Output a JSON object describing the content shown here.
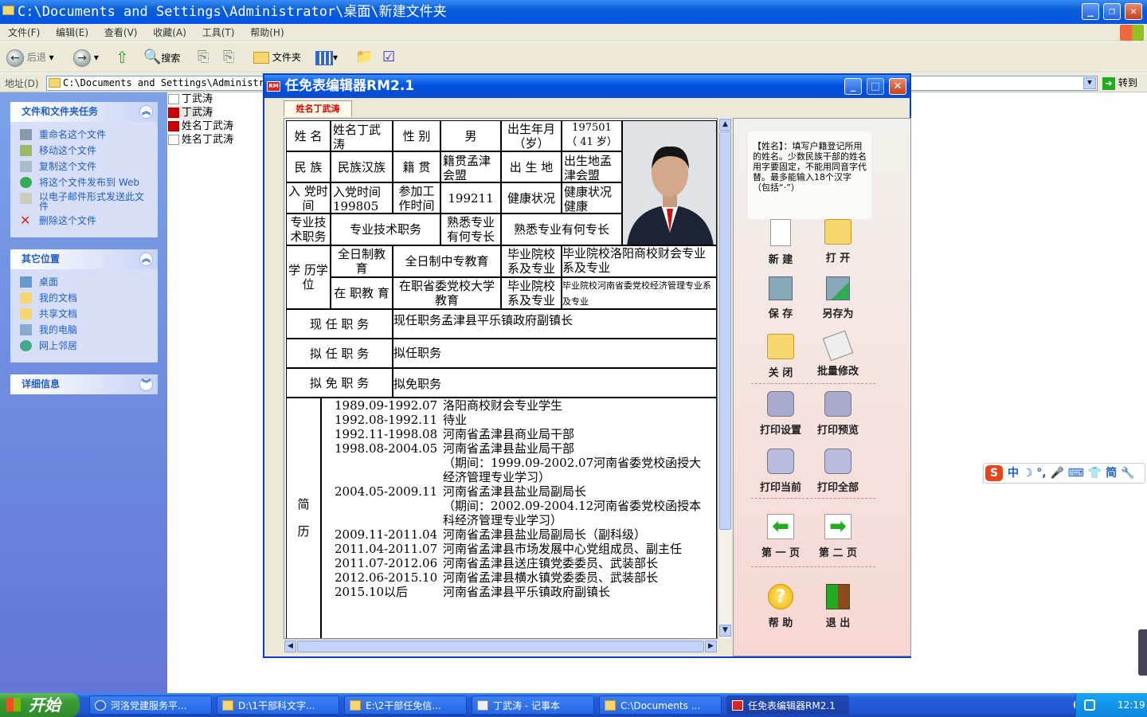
{
  "explorer": {
    "title": "C:\\Documents and Settings\\Administrator\\桌面\\新建文件夹",
    "menu": [
      "文件(F)",
      "编辑(E)",
      "查看(V)",
      "收藏(A)",
      "工具(T)",
      "帮助(H)"
    ],
    "toolbar": {
      "back": "后退",
      "search": "搜索",
      "folders": "文件夹"
    },
    "address_label": "地址(D)",
    "address_value": "C:\\Documents and Settings\\Administra",
    "go": "转到"
  },
  "tasks_panel": {
    "title": "文件和文件夹任务",
    "items": [
      "重命名这个文件",
      "移动这个文件",
      "复制这个文件",
      "将这个文件发布到 Web",
      "以电子邮件形式发送此文件",
      "删除这个文件"
    ]
  },
  "other_places": {
    "title": "其它位置",
    "items": [
      "桌面",
      "我的文档",
      "共享文档",
      "我的电脑",
      "网上邻居"
    ]
  },
  "details": {
    "title": "详细信息"
  },
  "files": [
    "丁武涛",
    "丁武涛",
    "姓名丁武涛",
    "姓名丁武涛"
  ],
  "editor": {
    "title": "任免表编辑器RM2.1",
    "tab": "姓名丁武涛",
    "tip": "【姓名】：填写户籍登记所用的姓名。少数民族干部的姓名用字要固定，不能用同音字代替。最多能输入18个汉字（包括“·”）",
    "buttons": {
      "new": "新  建",
      "open": "打  开",
      "save": "保  存",
      "saveas": "另存为",
      "close": "关  闭",
      "batch": "批量修改",
      "print_setup": "打印设置",
      "print_preview": "打印预览",
      "print_current": "打印当前",
      "print_all": "打印全部",
      "page1": "第 一 页",
      "page2": "第 二 页",
      "help": "帮  助",
      "exit": "退  出"
    }
  },
  "form": {
    "name_label": "姓  名",
    "name": "姓名丁武涛",
    "sex_label": "性  别",
    "sex": "男",
    "birth_label": "出生年月（岁）",
    "birth": "197501",
    "age": "（ 41 岁）",
    "nation_label": "民  族",
    "nation": "民族汉族",
    "native_label": "籍  贯",
    "native": "籍贯孟津会盟",
    "birthplace_label": "出 生 地",
    "birthplace": "出生地孟津会盟",
    "party_label": "入  党时  间",
    "party": "入党时间199805",
    "work_label": "参加工作时间",
    "work": "199211",
    "health_label": "健康状况",
    "health": "健康状况健康",
    "tech_label": "专业技术职务",
    "tech": "专业技术职务",
    "skill_label": "熟悉专业有何专长",
    "skill": "熟悉专业有何专长",
    "edu_label": "学 历学 位",
    "fulltime_label": "全日制教  育",
    "fulltime": "全日制中专教育",
    "school_label1": "毕业院校系及专业",
    "school1": "毕业院校洛阳商校财会专业系及专业",
    "inservice_label": "在  职教  育",
    "inservice": "在职省委党校大学教育",
    "school_label2": "毕业院校系及专业",
    "school2": "毕业院校河南省委党校经济管理专业系及专业",
    "current_label": "现 任 职 务",
    "current": "现任职务孟津县平乐镇政府副镇长",
    "proposed_label": "拟 任 职 务",
    "proposed": "拟任职务",
    "remove_label": "拟 免 职 务",
    "remove": "拟免职务",
    "resume_label_1": "简",
    "resume_label_2": "历",
    "resume": [
      {
        "period": "1989.09-1992.07",
        "desc": "洛阳商校财会专业学生"
      },
      {
        "period": "1992.08-1992.11",
        "desc": "待业"
      },
      {
        "period": "1992.11-1998.08",
        "desc": "河南省孟津县商业局干部"
      },
      {
        "period": "1998.08-2004.05",
        "desc": "河南省孟津县盐业局干部"
      },
      {
        "period": "",
        "desc": "（期间：1999.09-2002.07河南省委党校函授大"
      },
      {
        "period": "",
        "desc": "经济管理专业学习）"
      },
      {
        "period": "2004.05-2009.11",
        "desc": "河南省孟津县盐业局副局长"
      },
      {
        "period": "",
        "desc": "（期间：2002.09-2004.12河南省委党校函授本"
      },
      {
        "period": "",
        "desc": "科经济管理专业学习）"
      },
      {
        "period": "2009.11-2011.04",
        "desc": "河南省孟津县盐业局副局长（副科级）"
      },
      {
        "period": "2011.04-2011.07",
        "desc": "河南省孟津县市场发展中心党组成员、副主任"
      },
      {
        "period": "2011.07-2012.06",
        "desc": "河南省孟津县送庄镇党委委员、武装部长"
      },
      {
        "period": "2012.06-2015.10",
        "desc": "河南省孟津县横水镇党委委员、武装部长"
      },
      {
        "period": "2015.10以后",
        "desc": "河南省孟津县平乐镇政府副镇长"
      }
    ]
  },
  "ime": "中 ☽ °, 🎤 ⌨ 👕 简 🔧",
  "taskbar": {
    "start": "开始",
    "tasks": [
      "河洛党建服务平...",
      "D:\\1干部科文字...",
      "E:\\2干部任免信...",
      "丁武涛 - 记事本",
      "C:\\Documents ...",
      "任免表编辑器RM2.1"
    ],
    "clock": "12:19"
  }
}
